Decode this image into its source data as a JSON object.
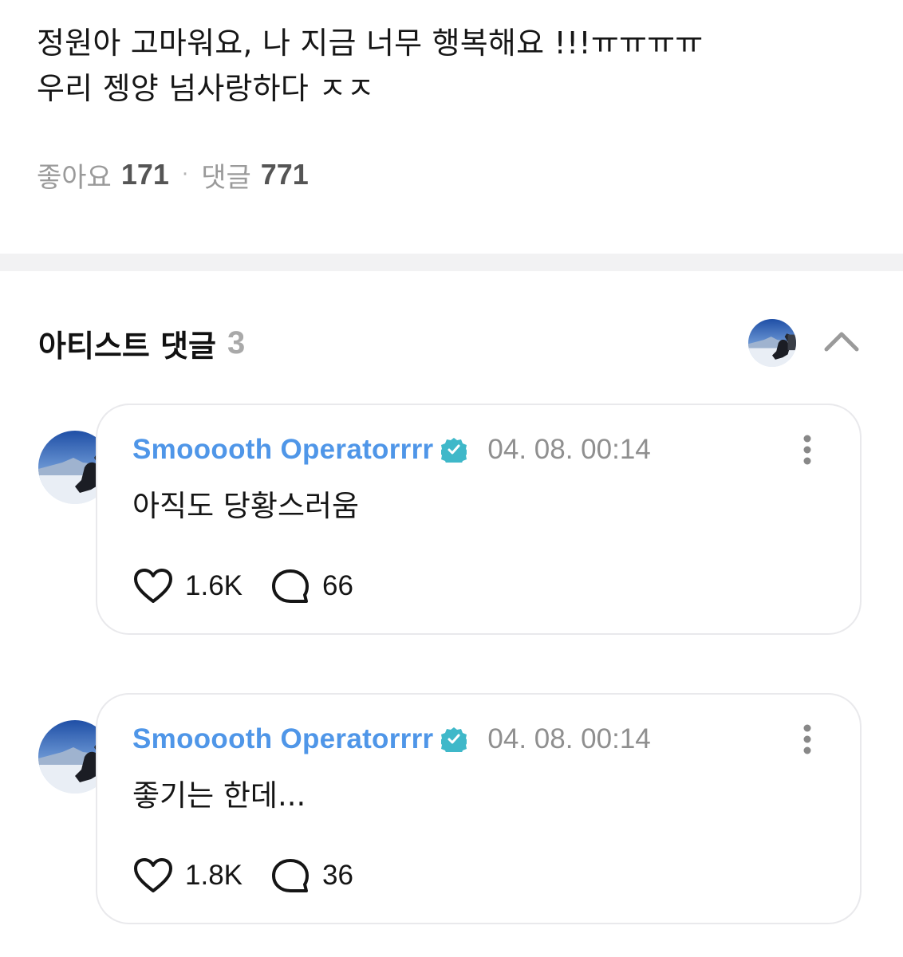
{
  "post": {
    "line1": "정원아 고마워요, 나 지금 너무 행복해요 !!!ㅠㅠㅠㅠ",
    "line2": "우리 젱양 넘사랑하다 ㅈㅈ"
  },
  "stats": {
    "likes_label": "좋아요",
    "likes_count": "171",
    "separator": "·",
    "comments_label": "댓글",
    "comments_count": "771"
  },
  "artist_comments": {
    "title": "아티스트 댓글",
    "count": "3",
    "collapse_icon": "chevron-up-icon"
  },
  "comments": [
    {
      "author": "Smooooth Operatorrrr",
      "verified": true,
      "timestamp": "04. 08. 00:14",
      "text": "아직도 당황스러움",
      "likes": "1.6K",
      "replies": "66"
    },
    {
      "author": "Smooooth Operatorrrr",
      "verified": true,
      "timestamp": "04. 08. 00:14",
      "text": "좋기는 한데...",
      "likes": "1.8K",
      "replies": "36"
    }
  ],
  "colors": {
    "author": "#4f96e8",
    "verified_badge": "#3fb8c9",
    "muted": "#9a9a9a",
    "divider": "#f2f2f3",
    "card_border": "#e9e9ec"
  }
}
